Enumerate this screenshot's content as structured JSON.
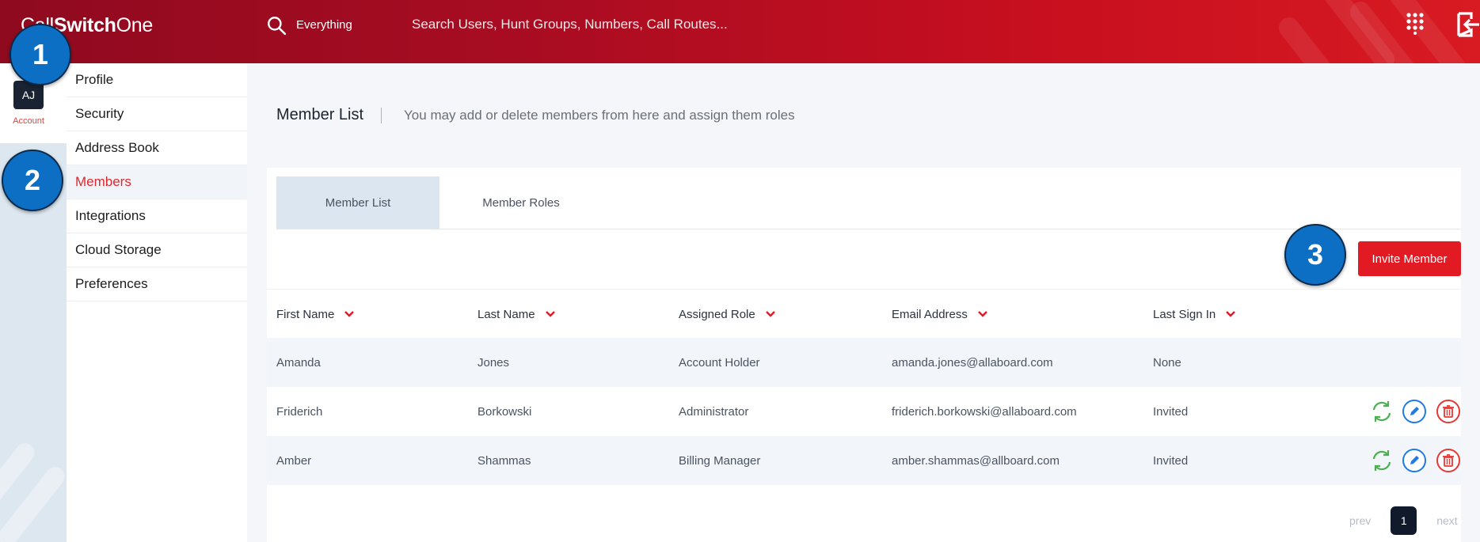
{
  "topbar": {
    "logo_prefix": "Call",
    "logo_bold": "Switch",
    "logo_suffix": "One",
    "search_scope": "Everything",
    "search_placeholder": "Search Users, Hunt Groups, Numbers, Call Routes..."
  },
  "rail": {
    "avatar_initials": "AJ",
    "account_label": "Account"
  },
  "sidebar": {
    "items": [
      {
        "label": "Profile"
      },
      {
        "label": "Security"
      },
      {
        "label": "Address Book"
      },
      {
        "label": "Members"
      },
      {
        "label": "Integrations"
      },
      {
        "label": "Cloud Storage"
      },
      {
        "label": "Preferences"
      }
    ],
    "active_index": 3
  },
  "main": {
    "title": "Member List",
    "description": "You may add or delete members from here and assign them roles",
    "tabs": [
      {
        "label": "Member List"
      },
      {
        "label": "Member Roles"
      }
    ],
    "invite_button": "Invite Member",
    "columns": [
      "First Name",
      "Last Name",
      "Assigned Role",
      "Email Address",
      "Last Sign In"
    ],
    "rows": [
      {
        "first": "Amanda",
        "last": "Jones",
        "role": "Account Holder",
        "email": "amanda.jones@allaboard.com",
        "last_sign_in": "None"
      },
      {
        "first": "Friderich",
        "last": "Borkowski",
        "role": "Administrator",
        "email": "friderich.borkowski@allaboard.com",
        "last_sign_in": "Invited"
      },
      {
        "first": "Amber",
        "last": "Shammas",
        "role": "Billing Manager",
        "email": "amber.shammas@allboard.com",
        "last_sign_in": "Invited"
      }
    ],
    "pagination": {
      "prev": "prev",
      "current": "1",
      "next": "next"
    }
  },
  "callouts": [
    "1",
    "2",
    "3"
  ],
  "colors": {
    "brand_red": "#e21a23",
    "active_menu_text": "#e0262d",
    "resend_green": "#4caf50",
    "edit_blue": "#1e7be6",
    "delete_red": "#e53935",
    "callout_blue": "#0d6fc4"
  },
  "icons": [
    "search-icon",
    "dialpad-icon",
    "logout-icon",
    "chevron-down-icon",
    "resend-invite-icon",
    "edit-icon",
    "delete-icon"
  ]
}
